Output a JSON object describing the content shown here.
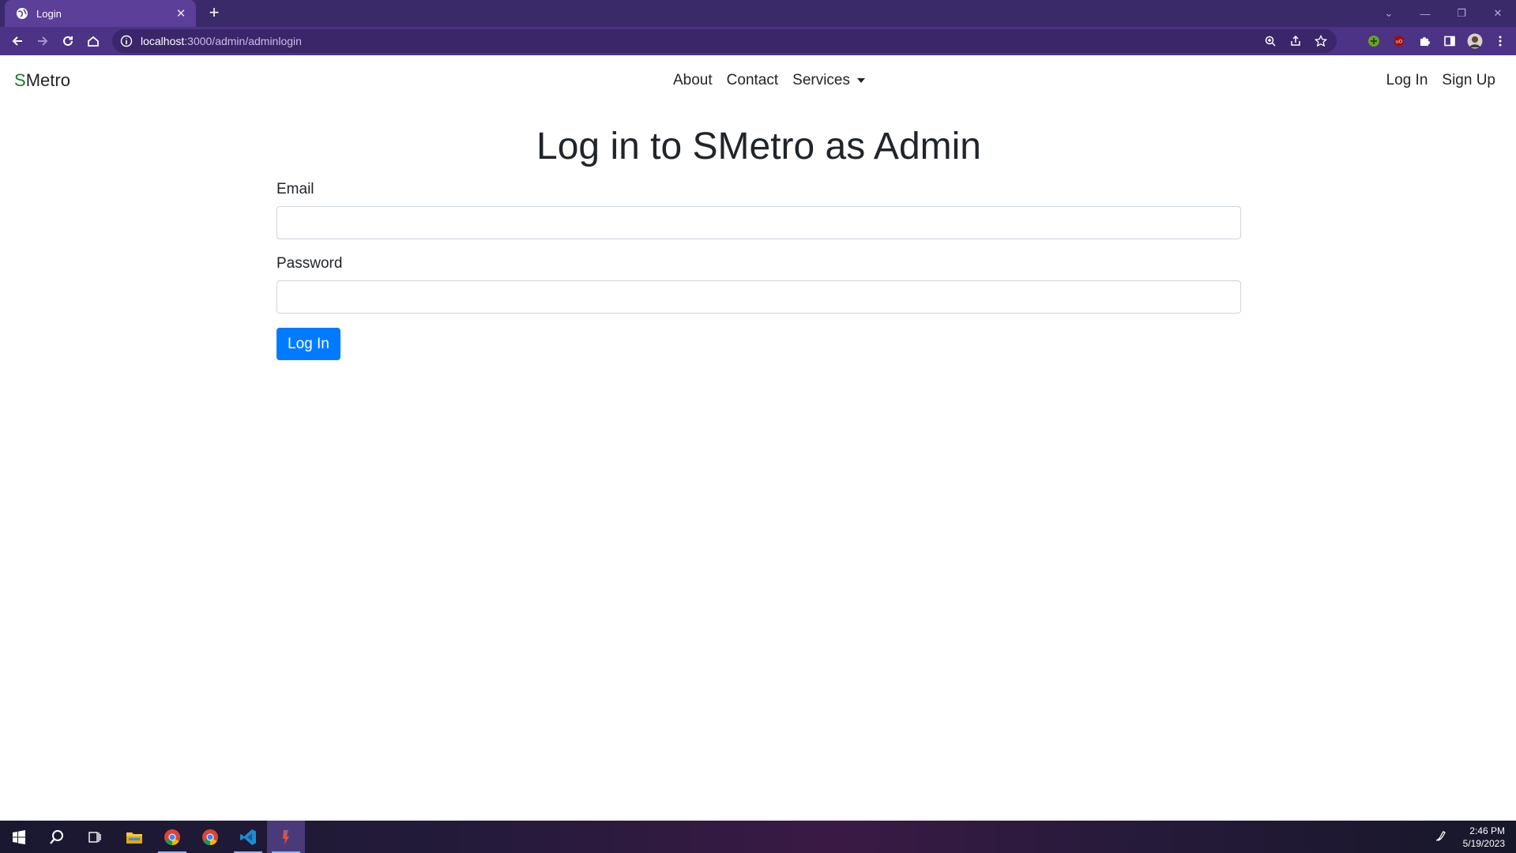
{
  "browser": {
    "tab_title": "Login",
    "url_host": "localhost",
    "url_rest": ":3000/admin/adminlogin"
  },
  "navbar": {
    "brand_s": "S",
    "brand_rest": "Metro",
    "about": "About",
    "contact": "Contact",
    "services": "Services",
    "login": "Log In",
    "signup": "Sign Up"
  },
  "form": {
    "heading": "Log in to SMetro as Admin",
    "email_label": "Email",
    "email_value": "",
    "password_label": "Password",
    "password_value": "",
    "submit_label": "Log In"
  },
  "taskbar": {
    "time": "2:46 PM",
    "date": "5/19/2023"
  },
  "colors": {
    "primary": "#007bff",
    "brand_green": "#1a7a33",
    "chrome_purple": "#4c3386"
  }
}
